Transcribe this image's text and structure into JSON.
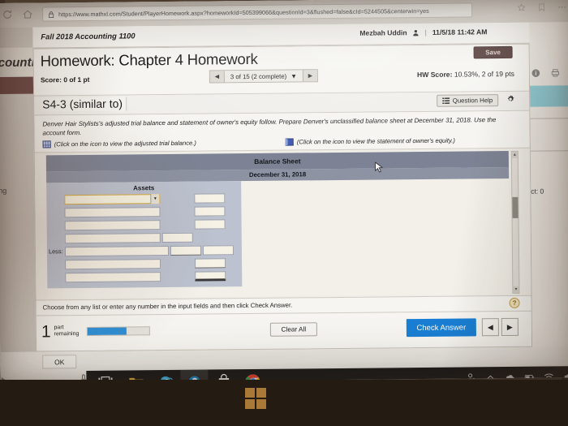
{
  "browser": {
    "url": "https://www.mathxl.com/Student/PlayerHomework.aspx?homeworkId=505399066&questionId=3&flushed=false&cId=5244505&centerwin=yes",
    "icons": [
      "refresh-icon",
      "home-icon",
      "lock-icon"
    ]
  },
  "course": {
    "title": "Fall 2018 Accounting 1100",
    "user_name": "Mezbah Uddin",
    "divider": "|",
    "timestamp": "11/5/18 11:42 AM"
  },
  "background": {
    "left_tab_text": "countin",
    "left_word": "ng",
    "right_word": "ct: 0"
  },
  "homework": {
    "title": "Homework: Chapter 4 Homework",
    "save_label": "Save",
    "score_label": "Score: 0 of 1 pt",
    "nav": {
      "prev": "◀",
      "next": "▶",
      "position": "3 of 15 (2 complete)",
      "dropdown": "▼"
    },
    "hw_score_label": "HW Score:",
    "hw_score_value": "10.53%, 2 of 19 pts",
    "question_id": "S4-3 (similar to)",
    "question_help_label": "Question Help",
    "gear": "gear-icon"
  },
  "prompt": {
    "line1": "Denver Hair Stylists's adjusted trial balance and statement of owner's equity follow. Prepare Denver's ",
    "emphasis": "unclassified",
    "line2": " balance sheet at December 31, 2018. Use the account form.",
    "link1": "(Click on the icon to view the adjusted trial balance.)",
    "link2": "(Click on the icon to view the statement of owner's equity.)"
  },
  "balance_sheet": {
    "title": "Balance Sheet",
    "date": "December 31, 2018",
    "section_heading": "Assets",
    "less_label": "Less:",
    "rows": [
      {
        "name": "",
        "mid": "",
        "right": "",
        "focused": true,
        "has_mid": false,
        "has_right": true,
        "underline_mid": "",
        "underline_right": ""
      },
      {
        "name": "",
        "mid": "",
        "right": "",
        "focused": false,
        "has_mid": false,
        "has_right": true,
        "underline_mid": "",
        "underline_right": ""
      },
      {
        "name": "",
        "mid": "",
        "right": "",
        "focused": false,
        "has_mid": false,
        "has_right": true,
        "underline_mid": "",
        "underline_right": ""
      },
      {
        "name": "",
        "mid": "",
        "right": "",
        "focused": false,
        "has_mid": true,
        "has_right": false,
        "underline_mid": "",
        "underline_right": ""
      },
      {
        "name": "",
        "mid": "",
        "right": "",
        "focused": false,
        "has_mid": true,
        "has_right": true,
        "underline_mid": "thin",
        "underline_right": "",
        "label": "Less:"
      },
      {
        "name": "",
        "mid": "",
        "right": "",
        "focused": false,
        "has_mid": false,
        "has_right": true,
        "underline_mid": "",
        "underline_right": "thin"
      },
      {
        "name": "",
        "mid": "",
        "right": "",
        "focused": false,
        "has_mid": false,
        "has_right": true,
        "underline_mid": "",
        "underline_right": "thick"
      }
    ]
  },
  "footer": {
    "instruction": "Choose from any list or enter any number in the input fields and then click Check Answer.",
    "help_icon": "?",
    "parts_number": "1",
    "parts_line1": "part",
    "parts_line2": "remaining",
    "progress_percent": 62,
    "clear_all_label": "Clear All",
    "check_answer_label": "Check Answer",
    "pager_prev": "◀",
    "pager_next": "▶"
  },
  "dialog": {
    "ok_label": "OK"
  },
  "taskbar": {
    "apps": [
      "task-view-icon",
      "file-explorer-icon",
      "internet-explorer-icon",
      "edge-icon",
      "microsoft-store-icon",
      "chrome-icon"
    ],
    "tray": [
      "people-icon",
      "chevron-up-icon",
      "onedrive-icon",
      "battery-icon",
      "wifi-icon",
      "volume-icon"
    ],
    "start": "windows-start-icon"
  },
  "colors": {
    "accent_blue": "#1a7fd4",
    "sheet_header": "#7d8394",
    "save_btn": "#5a4340",
    "teal_row": "#8ecbd6",
    "focus_orange": "#d3a43c"
  }
}
